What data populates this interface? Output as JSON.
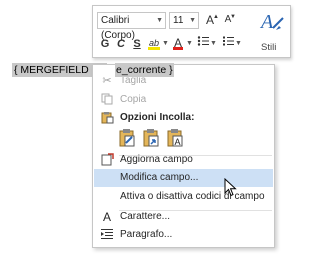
{
  "minibar": {
    "font_name": "Calibri (Corpo)",
    "font_size": "11",
    "grow_label": "A",
    "shrink_label": "A",
    "bold_label": "G",
    "italic_label": "C",
    "underline_label": "S",
    "highlight_label": "ab",
    "fontcolor_label": "A",
    "styles_label": "Stili",
    "colors": {
      "highlight": "#f5e500",
      "font": "#e0201b",
      "styles": "#2a65b2"
    }
  },
  "field_code": {
    "left_text": "{ MERGEFIELD Da",
    "right_text": "e_corrente }"
  },
  "menu": {
    "taglia": "Taglia",
    "copia": "Copia",
    "opzioni_incolla": "Opzioni Incolla:",
    "aggiorna": "Aggiorna campo",
    "modifica": "Modifica campo...",
    "attiva": "Attiva o disattiva codici di campo",
    "carattere": "Carattere...",
    "paragrafo": "Paragrafo...",
    "hover_color": "#cde0f5"
  }
}
